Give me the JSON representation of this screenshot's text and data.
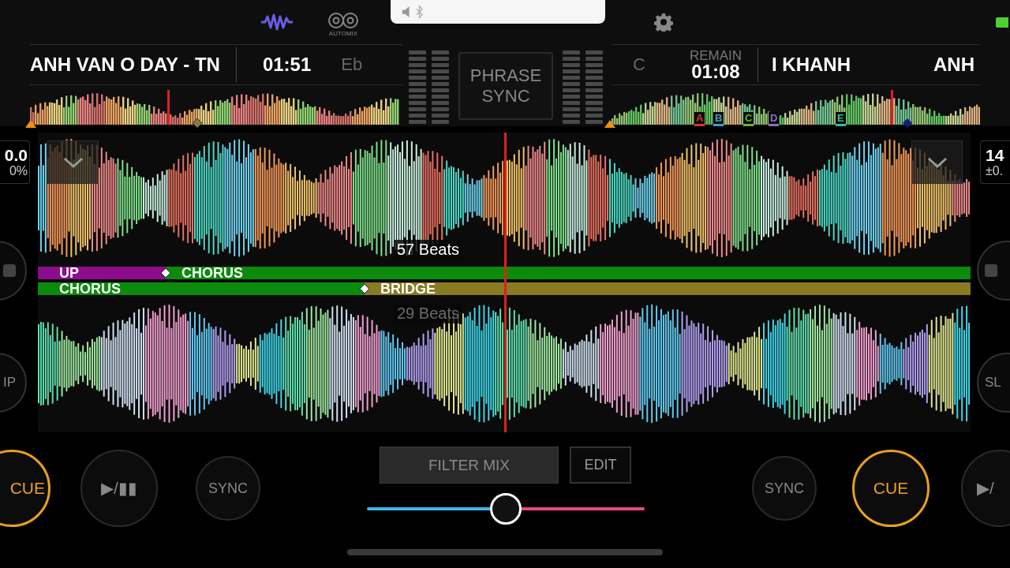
{
  "toolbar": {
    "automix_label": "AUTOMIX"
  },
  "deck_a": {
    "title": "ANH VAN O DAY - TN",
    "time": "01:51",
    "key": "Eb",
    "bpm": "0.0",
    "pitch": "0%",
    "side_buttons": [
      {
        "kind": "icon"
      },
      {
        "kind": "text",
        "label": "IP"
      }
    ],
    "beats": "57 Beats",
    "phrases": [
      {
        "label": "UP",
        "color": "#8c0c8c"
      },
      {
        "label": "CHORUS",
        "color": "#0c8a0c"
      }
    ],
    "buttons": {
      "cue": "CUE",
      "play": "▶/▮▮",
      "sync": "SYNC"
    }
  },
  "phrase_sync": "PHRASE SYNC",
  "deck_b": {
    "key": "C",
    "remain_label": "REMAIN",
    "time": "01:08",
    "title_left": "I KHANH",
    "title_right": "ANH",
    "cue_markers": [
      {
        "label": "A",
        "color": "#d83a22"
      },
      {
        "label": "B",
        "color": "#3aa0c8"
      },
      {
        "label": "C",
        "color": "#6ab83a"
      },
      {
        "label": "D",
        "color": "#8a70c8"
      },
      {
        "label": "E",
        "color": "#3ab8a0"
      }
    ],
    "bpm": "14",
    "pitch": "±0.",
    "side_buttons": [
      {
        "kind": "icon"
      },
      {
        "kind": "text",
        "label": "SL"
      }
    ],
    "beats": "29 Beats",
    "phrases": [
      {
        "label": "CHORUS",
        "color": "#0c8a0c"
      },
      {
        "label": "BRIDGE",
        "color": "#8a7a22"
      }
    ],
    "buttons": {
      "sync": "SYNC",
      "cue": "CUE",
      "play": "▶/"
    }
  },
  "mixer": {
    "filter_label": "FILTER MIX",
    "edit_label": "EDIT",
    "crossfader": {
      "level": 0.5
    }
  }
}
